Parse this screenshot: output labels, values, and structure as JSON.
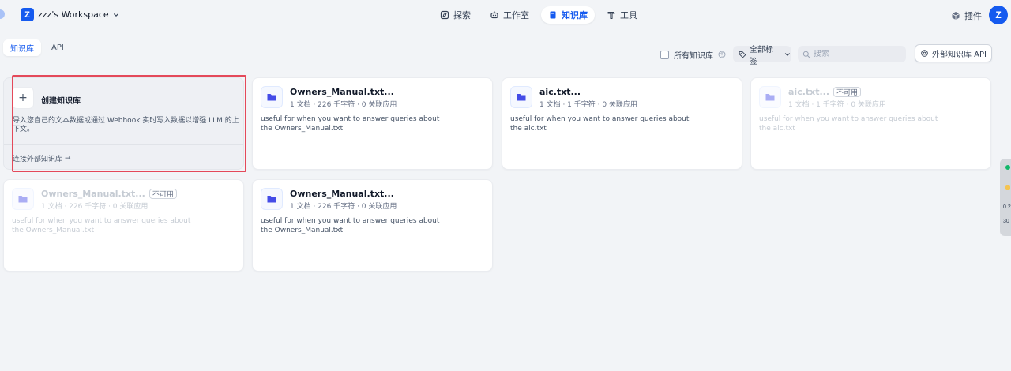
{
  "workspace": {
    "badge": "Z",
    "name": "zzz's Workspace"
  },
  "nav": [
    {
      "label": "探索",
      "icon": "explore-icon"
    },
    {
      "label": "工作室",
      "icon": "robot-icon"
    },
    {
      "label": "知识库",
      "icon": "book-icon",
      "active": true
    },
    {
      "label": "工具",
      "icon": "hammer-icon"
    }
  ],
  "plugins": {
    "label": "插件",
    "icon": "cube-icon"
  },
  "avatar": {
    "initial": "Z"
  },
  "subtabs": [
    {
      "label": "知识库",
      "active": true
    },
    {
      "label": "API",
      "active": false
    }
  ],
  "toolbar": {
    "all_kb_label": "所有知识库",
    "tag_filter_label": "全部标签",
    "search_placeholder": "搜索",
    "external_api_label": "外部知识库 API"
  },
  "create_card": {
    "title": "创建知识库",
    "description": "导入您自己的文本数据或通过 Webhook 实时写入数据以增强 LLM 的上下文。",
    "link": "连接外部知识库",
    "link_arrow": "→"
  },
  "cards": [
    {
      "title": "Owners_Manual.txt...",
      "meta": "1 文档 · 226 千字符 · 0 关联应用",
      "description": "useful for when you want to answer queries about the Owners_Manual.txt",
      "disabled": false,
      "badge": ""
    },
    {
      "title": "aic.txt...",
      "meta": "1 文档 · 1 千字符 · 0 关联应用",
      "description": "useful for when you want to answer queries about the aic.txt",
      "disabled": false,
      "badge": ""
    },
    {
      "title": "aic.txt...",
      "meta": "1 文档 · 1 千字符 · 0 关联应用",
      "description": "useful for when you want to answer queries about the aic.txt",
      "disabled": true,
      "badge": "不可用"
    },
    {
      "title": "Owners_Manual.txt...",
      "meta": "1 文档 · 226 千字符 · 0 关联应用",
      "description": "useful for when you want to answer queries about the Owners_Manual.txt",
      "disabled": true,
      "badge": "不可用"
    },
    {
      "title": "Owners_Manual.txt...",
      "meta": "1 文档 · 226 千字符 · 0 关联应用",
      "description": "useful for when you want to answer queries about the Owners_Manual.txt",
      "disabled": false,
      "badge": ""
    }
  ],
  "edge_widget": {
    "line1": "0.2",
    "line2": "30"
  },
  "colors": {
    "accent": "#155aef",
    "highlight": "#e4495a",
    "background": "#f2f4f7"
  }
}
